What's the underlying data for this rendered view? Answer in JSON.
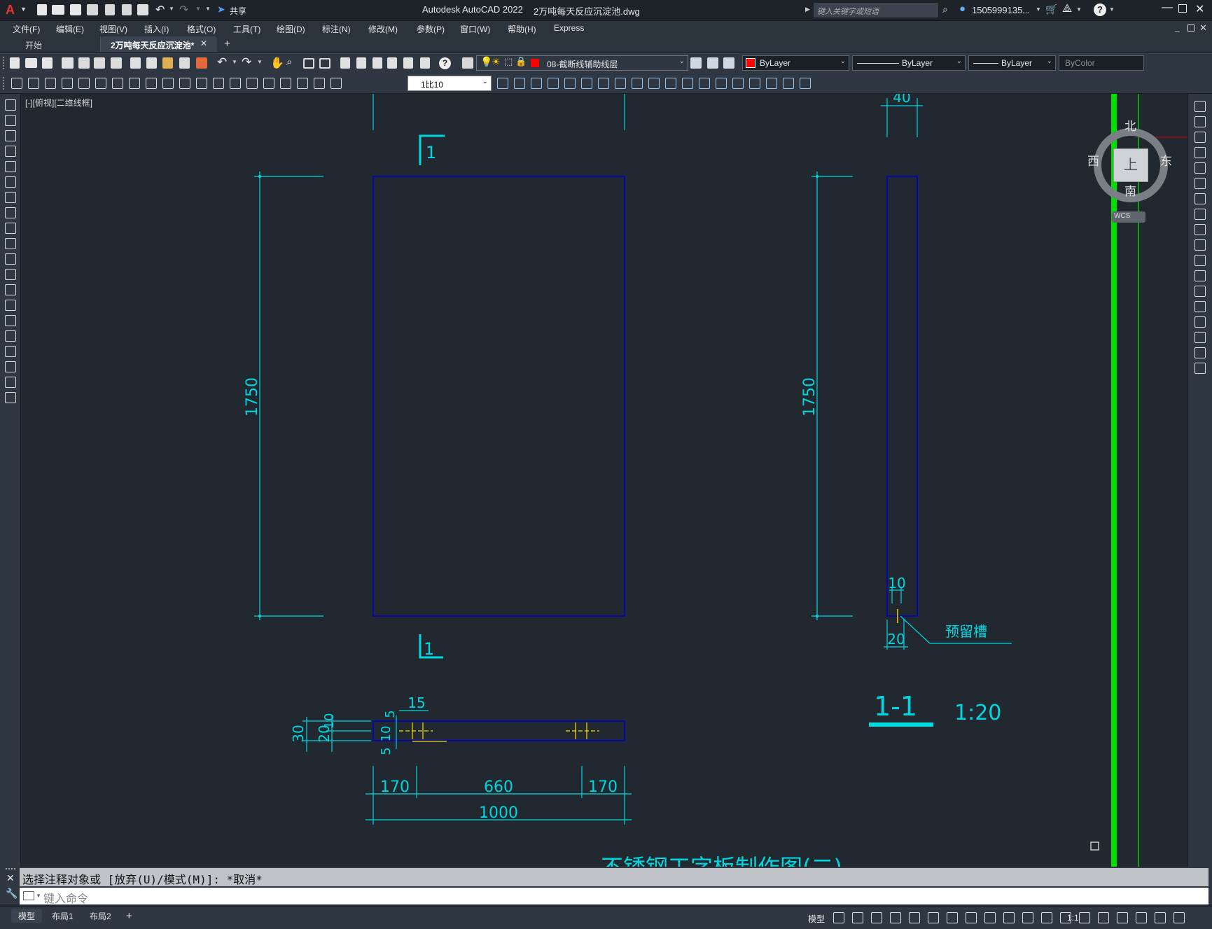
{
  "app": {
    "title": "Autodesk AutoCAD 2022",
    "document": "2万吨每天反应沉淀池.dwg",
    "logo_letter": "A",
    "share_label": "共享",
    "search_placeholder": "键入关键字或短语",
    "user": "1505999135...",
    "help_glyph": "?"
  },
  "menu": {
    "items": [
      "文件(F)",
      "编辑(E)",
      "视图(V)",
      "插入(I)",
      "格式(O)",
      "工具(T)",
      "绘图(D)",
      "标注(N)",
      "修改(M)",
      "参数(P)",
      "窗口(W)",
      "帮助(H)",
      "Express"
    ]
  },
  "tabs": [
    {
      "label": "开始",
      "active": false
    },
    {
      "label": "2万吨每天反应沉淀池*",
      "active": true
    }
  ],
  "tab_close": "✕",
  "tab_add": "+",
  "properties": {
    "layer": "08-截断线辅助线层",
    "color": "ByLayer",
    "linetype": "ByLayer",
    "lineweight": "ByLayer",
    "plotstyle": "ByColor",
    "annotation_scale": "1比10"
  },
  "viewport_label": "[-][俯视][二维线框]",
  "viewcube": {
    "north": "北",
    "south": "南",
    "east": "东",
    "west": "西",
    "top": "上",
    "wcs": "WCS"
  },
  "drawing": {
    "dim_height_left": "1750",
    "dim_height_right": "1750",
    "dim_width_top": "40",
    "dim_10": "10",
    "dim_20": "20",
    "slot_label": "预留槽",
    "section_mark": "1",
    "section_title": "1-1",
    "section_scale": "1:20",
    "dim_15": "15",
    "dim_5a": "5",
    "dim_10b": "10",
    "dim_5b": "5",
    "dim_30": "30",
    "dim_20b": "20",
    "dim_10c": "10",
    "dim_170a": "170",
    "dim_660": "660",
    "dim_170b": "170",
    "dim_1000": "1000",
    "bottom_title_partial": "不锈钢工字板制作图(二)"
  },
  "command": {
    "history": "选择注释对象或 [放弃(U)/模式(M)]: *取消*",
    "placeholder": "键入命令"
  },
  "status": {
    "layouts": [
      "模型",
      "布局1",
      "布局2"
    ],
    "add": "+",
    "model_label": "模型",
    "scale": "1:1"
  },
  "colors": {
    "dimension": "#00d7e0",
    "object": "#0000c8",
    "green_line": "#00e000",
    "yellow": "#ffe000",
    "canvas_bg": "#212830"
  }
}
